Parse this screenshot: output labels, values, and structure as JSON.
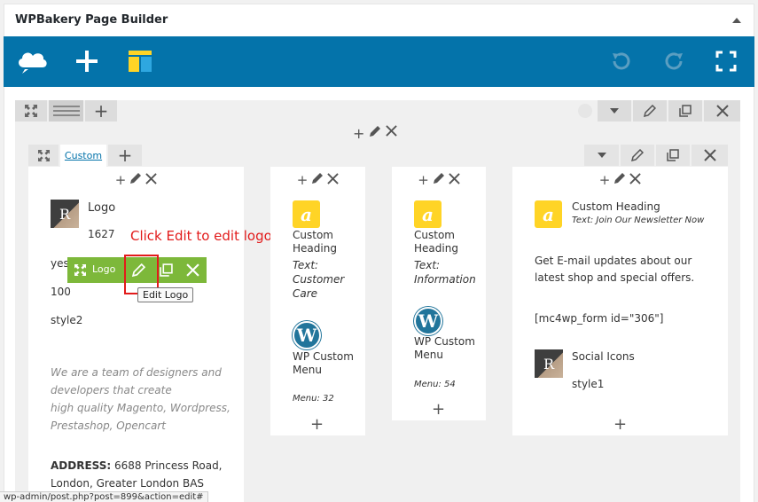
{
  "panel": {
    "title": "WPBakery Page Builder"
  },
  "row_tab": {
    "label": "Custom"
  },
  "columns": {
    "col1": {
      "logo_title": "Logo",
      "logo_id": "1627",
      "yes_text": "yes",
      "value_100": "100",
      "style_text": "style2",
      "about": [
        "We are a team of designers and",
        "developers that create",
        "high quality Magento, Wordpress,",
        "Prestashop, Opencart"
      ],
      "address_label": "ADDRESS:",
      "address_value": " 6688 Princess Road,",
      "address_line2": "London, Greater London BAS"
    },
    "col2": {
      "heading_title": "Custom Heading",
      "heading_sub": "Text: Customer Care",
      "menu_title": "WP Custom Menu",
      "menu_sub": "Menu: 32"
    },
    "col3": {
      "heading_title": "Custom Heading",
      "heading_sub": "Text: Information",
      "menu_title": "WP Custom Menu",
      "menu_sub": "Menu: 54"
    },
    "col4": {
      "heading_title": "Custom Heading",
      "heading_sub": "Text: Join Our Newsletter Now",
      "text_line1": "Get E-mail updates about our",
      "text_line2": "latest shop and special offers.",
      "shortcode": "[mc4wp_form id=\"306\"]",
      "social_title": "Social Icons",
      "social_style": "style1"
    }
  },
  "element_bar": {
    "label": "Logo"
  },
  "tooltip": {
    "text": "Edit Logo"
  },
  "annotation": {
    "text": "Click Edit to edit logo"
  },
  "status_bar": {
    "url": "wp-admin/post.php?post=899&action=edit#"
  },
  "colors": {
    "toolbar_blue": "#0473aa",
    "element_green": "#7db83a",
    "heading_yellow": "#ffd426",
    "annotation_red": "#e21b1b"
  },
  "icons": [
    "clouds-logo-icon",
    "plus-icon",
    "templates-icon",
    "undo-icon",
    "redo-icon",
    "fullscreen-icon",
    "expand-icon",
    "drag-handle-icon",
    "caret-down-icon",
    "pencil-icon",
    "copy-icon",
    "close-icon",
    "letter-a-icon",
    "wordpress-icon",
    "r-logo-icon"
  ]
}
